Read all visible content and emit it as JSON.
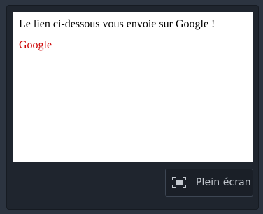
{
  "frame": {
    "text": "Le lien ci-dessous vous envoie sur Google !",
    "link_label": "Google"
  },
  "toolbar": {
    "fullscreen_label": "Plein écran",
    "fullscreen_icon": "fullscreen-icon"
  },
  "colors": {
    "background": "#2c3440",
    "panel": "#1f252e",
    "link": "#cc0000",
    "button_text": "#c3c8cf"
  }
}
